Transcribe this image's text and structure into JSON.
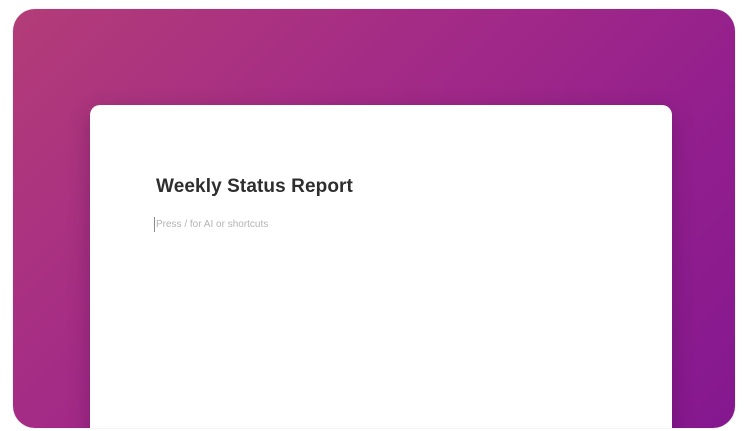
{
  "document": {
    "title": "Weekly Status Report",
    "placeholder": "Press / for AI or shortcuts"
  },
  "colors": {
    "background_gradient_start": "#b33c78",
    "background_gradient_end": "#85188f",
    "card": "#ffffff",
    "title_text": "#2e2e2e",
    "placeholder_text": "#b4b4b4"
  }
}
